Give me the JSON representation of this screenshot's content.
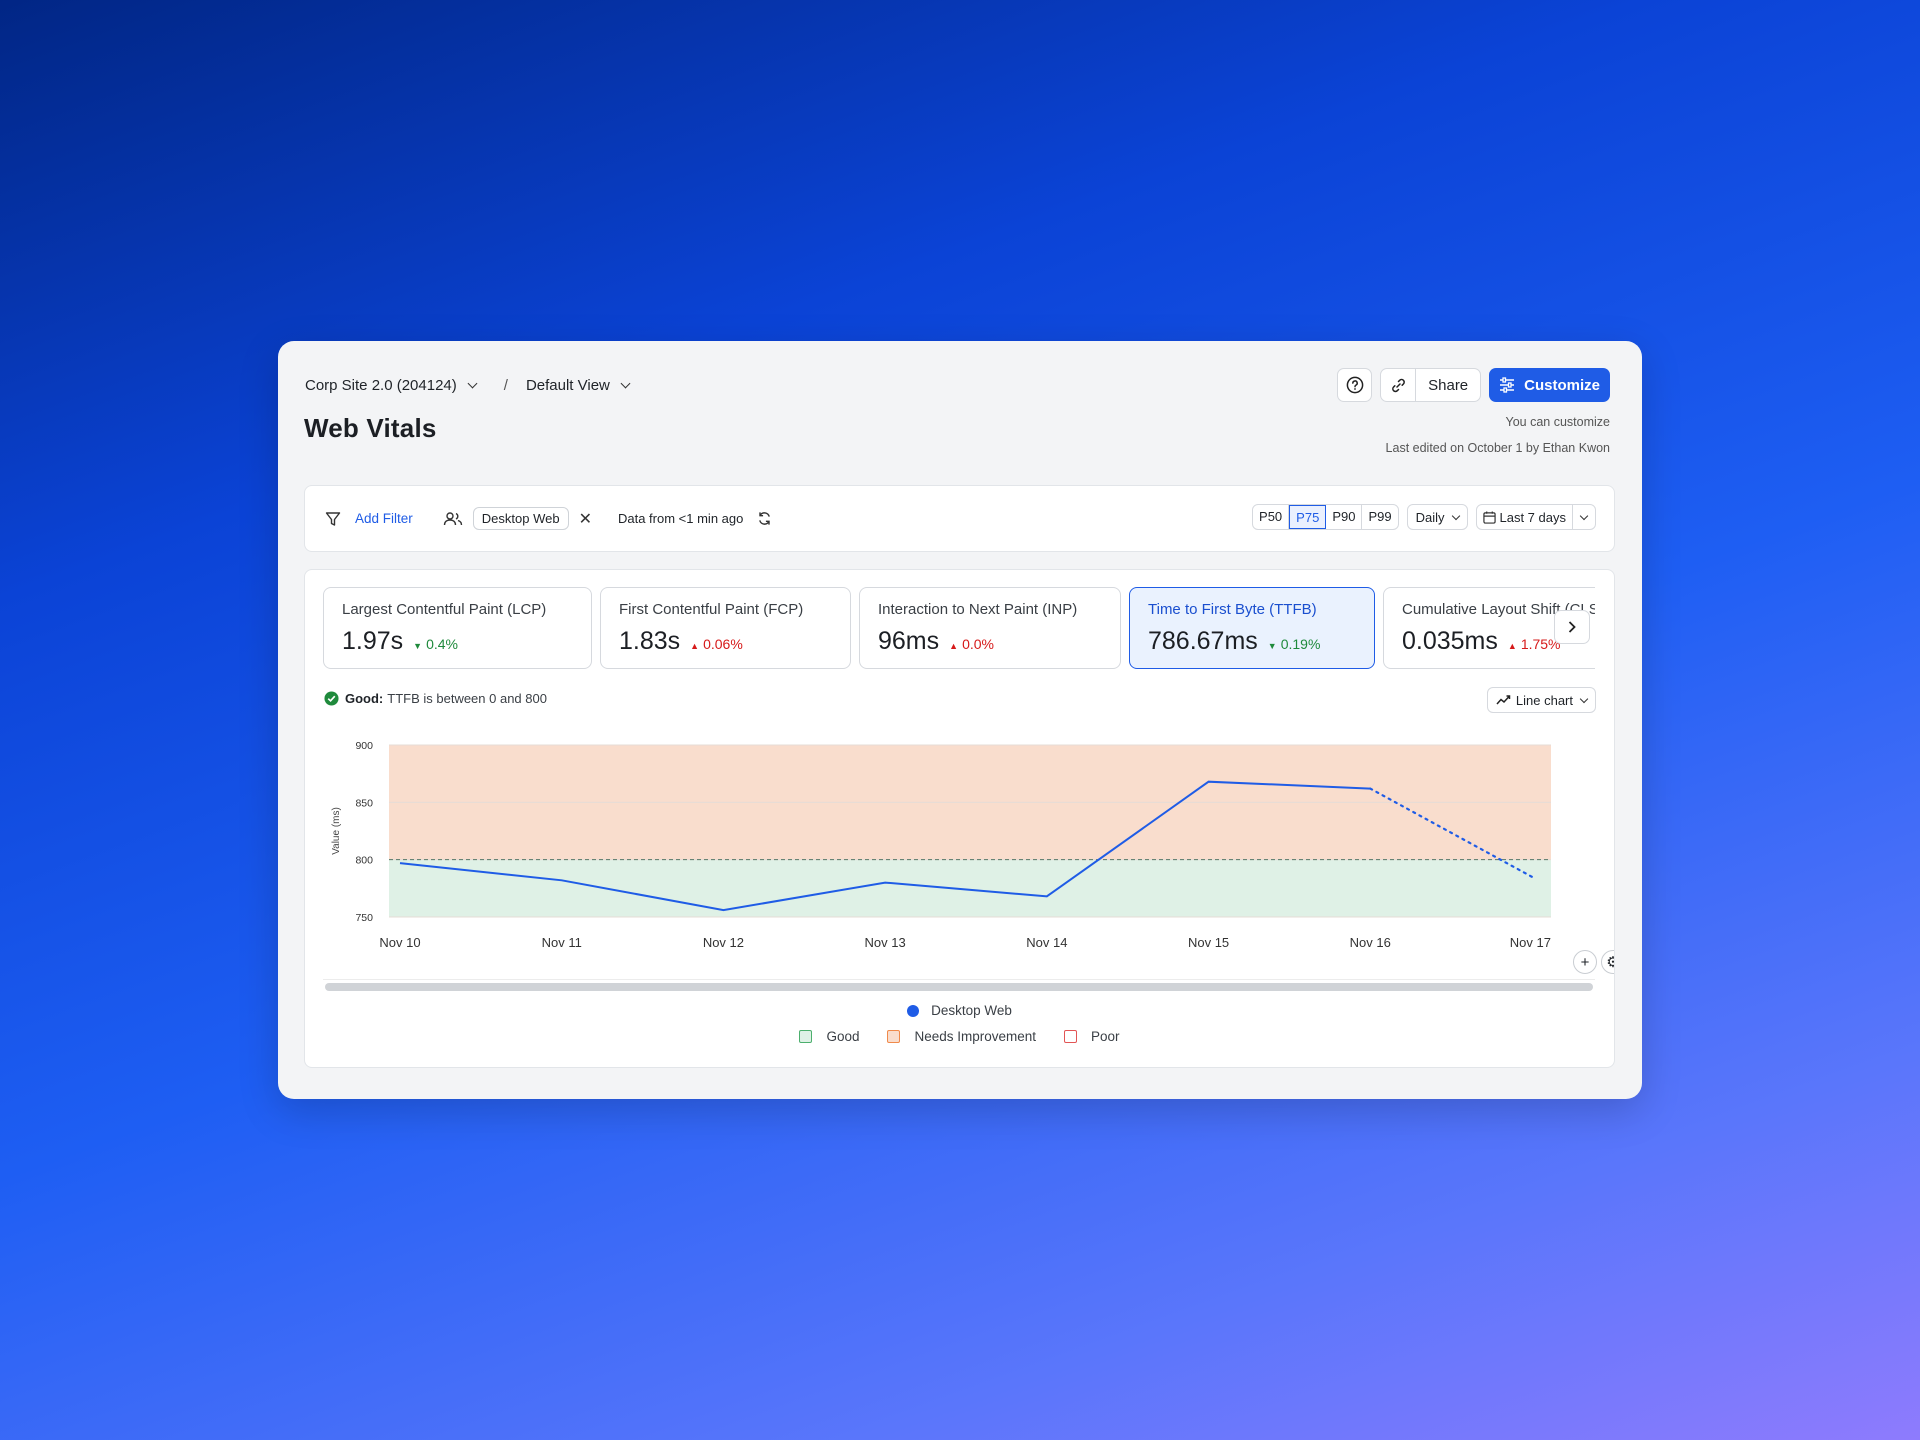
{
  "header": {
    "site_selector": "Corp Site 2.0 (204124)",
    "separator": "/",
    "view_selector": "Default View",
    "title": "Web Vitals",
    "share_label": "Share",
    "customize_label": "Customize",
    "meta_line1": "You can customize",
    "meta_line2": "Last edited on October 1  by Ethan Kwon"
  },
  "filters": {
    "add_filter_label": "Add Filter",
    "segment_chip": "Desktop Web",
    "remove_symbol": "✕",
    "data_freshness": "Data from <1 min ago",
    "percentiles": [
      "P50",
      "P75",
      "P90",
      "P99"
    ],
    "selected_percentile": "P75",
    "granularity": "Daily",
    "date_range": "Last 7 days"
  },
  "metrics": [
    {
      "name": "Largest Contentful Paint (LCP)",
      "value": "1.97s",
      "delta": "0.4%",
      "direction": "down"
    },
    {
      "name": "First Contentful Paint (FCP)",
      "value": "1.83s",
      "delta": "0.06%",
      "direction": "up"
    },
    {
      "name": "Interaction to Next Paint (INP)",
      "value": "96ms",
      "delta": "0.0%",
      "direction": "up"
    },
    {
      "name": "Time to First Byte (TTFB)",
      "value": "786.67ms",
      "delta": "0.19%",
      "direction": "down",
      "selected": true
    },
    {
      "name": "Cumulative Layout Shift (CLS)",
      "value": "0.035ms",
      "delta": "1.75%",
      "direction": "up"
    }
  ],
  "status": {
    "level": "Good:",
    "message": "TTFB is between 0 and 800"
  },
  "chart_type_button": "Line chart",
  "chart_data": {
    "type": "line",
    "ylabel": "Value (ms)",
    "ylim": [
      750,
      900
    ],
    "yticks": [
      900,
      850,
      800,
      750
    ],
    "x": [
      "Nov 10",
      "Nov 11",
      "Nov 12",
      "Nov 13",
      "Nov 14",
      "Nov 15",
      "Nov 16",
      "Nov 17"
    ],
    "series": [
      {
        "name": "Desktop Web",
        "color": "#1f5ce6",
        "values": [
          797,
          782,
          756,
          780,
          768,
          868,
          862,
          785
        ],
        "projected_from_index": 6
      }
    ],
    "threshold": 800,
    "bands": [
      {
        "name": "Good",
        "from": 750,
        "to": 800,
        "fill": "#dff1e6",
        "border": "#4caf6d"
      },
      {
        "name": "Needs Improvement",
        "from": 800,
        "to": 900,
        "fill": "#f9ddcd",
        "border": "#f08a4b"
      },
      {
        "name": "Poor",
        "border": "#e25555"
      }
    ]
  },
  "colors": {
    "accent": "#1f5ce6",
    "good": "#1f8a3c",
    "bad": "#d61a1a"
  }
}
